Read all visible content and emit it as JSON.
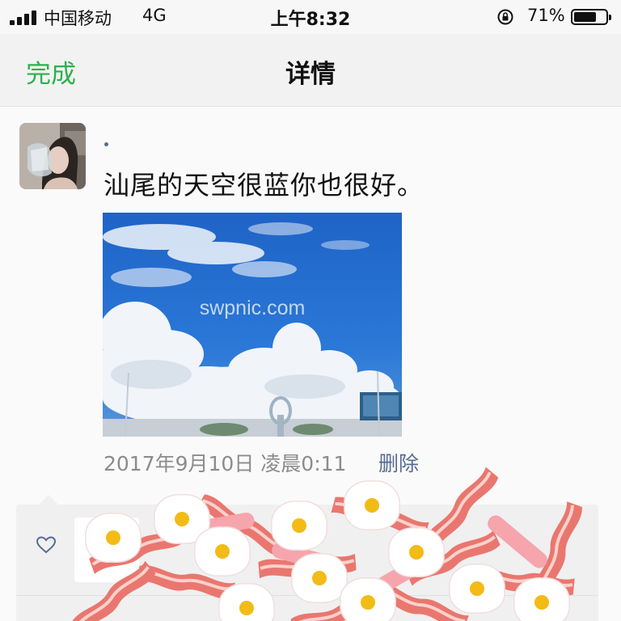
{
  "status_bar": {
    "carrier": "中国移动",
    "network": "4G",
    "time": "上午8:32",
    "battery_percent": "71%",
    "battery_level": 0.71,
    "icons": [
      "signal-icon",
      "orientation-lock-icon",
      "battery-icon"
    ]
  },
  "nav": {
    "done_label": "完成",
    "title": "详情"
  },
  "post": {
    "text": "汕尾的天空很蓝你也很好。",
    "photo_watermark": "swpnic.com",
    "date": "2017年9月10日 凌晨0:11",
    "delete_label": "删除"
  },
  "comments": {
    "like_icon": "heart-outline-icon"
  },
  "colors": {
    "accent_green": "#2bb24c",
    "link_blue": "#576b95",
    "meta_gray": "#8c8c8c",
    "sky_blue": "#1f63c6"
  }
}
